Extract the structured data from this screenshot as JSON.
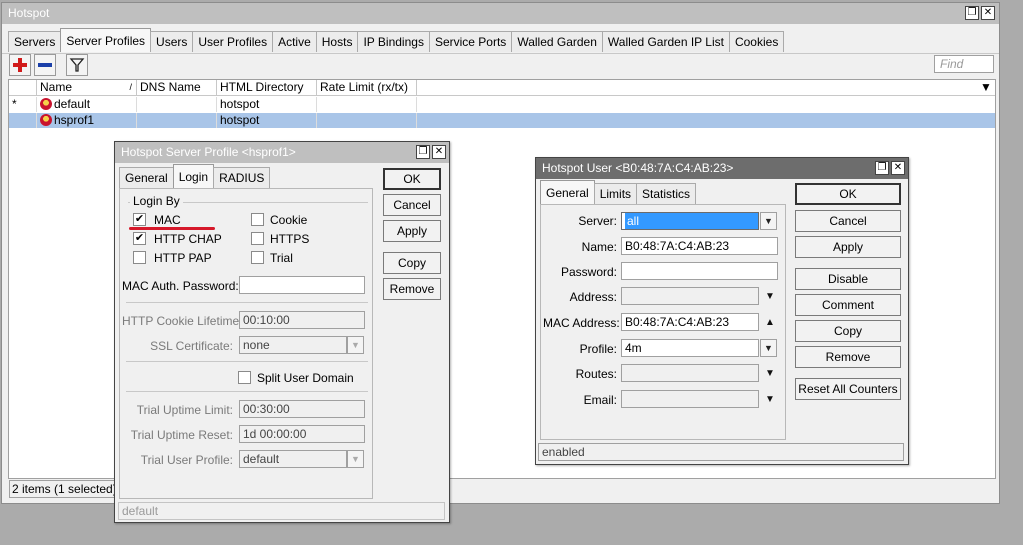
{
  "main": {
    "title": "Hotspot",
    "tabs": [
      "Servers",
      "Server Profiles",
      "Users",
      "User Profiles",
      "Active",
      "Hosts",
      "IP Bindings",
      "Service Ports",
      "Walled Garden",
      "Walled Garden IP List",
      "Cookies"
    ],
    "selected_tab": "Server Profiles",
    "find_placeholder": "Find",
    "columns": [
      "Name",
      "DNS Name",
      "HTML Directory",
      "Rate Limit (rx/tx)"
    ],
    "rows": [
      {
        "marker": "*",
        "name": "default",
        "dns": "",
        "html": "hotspot",
        "rate": "",
        "selected": false
      },
      {
        "marker": "",
        "name": "hsprof1",
        "dns": "",
        "html": "hotspot",
        "rate": "",
        "selected": true
      }
    ],
    "status": "2 items (1 selected)"
  },
  "profile_dialog": {
    "title": "Hotspot Server Profile <hsprof1>",
    "tabs": [
      "General",
      "Login",
      "RADIUS"
    ],
    "selected_tab": "Login",
    "login_by_title": "Login By",
    "checks": {
      "mac": {
        "label": "MAC",
        "checked": "✔"
      },
      "http_chap": {
        "label": "HTTP CHAP",
        "checked": "✔"
      },
      "http_pap": {
        "label": "HTTP PAP",
        "checked": ""
      },
      "cookie": {
        "label": "Cookie",
        "checked": ""
      },
      "https": {
        "label": "HTTPS",
        "checked": ""
      },
      "trial": {
        "label": "Trial",
        "checked": ""
      },
      "split": {
        "label": "Split User Domain",
        "checked": ""
      }
    },
    "mac_auth_password_label": "MAC Auth. Password:",
    "mac_auth_password": "",
    "http_cookie_lifetime_label": "HTTP Cookie Lifetime:",
    "http_cookie_lifetime": "00:10:00",
    "ssl_certificate_label": "SSL Certificate:",
    "ssl_certificate": "none",
    "trial_uptime_limit_label": "Trial Uptime Limit:",
    "trial_uptime_limit": "00:30:00",
    "trial_uptime_reset_label": "Trial Uptime Reset:",
    "trial_uptime_reset": "1d 00:00:00",
    "trial_user_profile_label": "Trial User Profile:",
    "trial_user_profile": "default",
    "buttons": {
      "ok": "OK",
      "cancel": "Cancel",
      "apply": "Apply",
      "copy": "Copy",
      "remove": "Remove"
    },
    "status": "default",
    "annotation_color": "#d6182a"
  },
  "user_dialog": {
    "title": "Hotspot User <B0:48:7A:C4:AB:23>",
    "tabs": [
      "General",
      "Limits",
      "Statistics"
    ],
    "selected_tab": "General",
    "server_label": "Server:",
    "server": "all",
    "name_label": "Name:",
    "name": "B0:48:7A:C4:AB:23",
    "password_label": "Password:",
    "password": "",
    "address_label": "Address:",
    "address": "",
    "mac_label": "MAC Address:",
    "mac": "B0:48:7A:C4:AB:23",
    "profile_label": "Profile:",
    "profile": "4m",
    "routes_label": "Routes:",
    "routes": "",
    "email_label": "Email:",
    "email": "",
    "buttons": {
      "ok": "OK",
      "cancel": "Cancel",
      "apply": "Apply",
      "disable": "Disable",
      "comment": "Comment",
      "copy": "Copy",
      "remove": "Remove",
      "reset": "Reset All Counters"
    },
    "status": "enabled"
  },
  "icons": {
    "add": "plus-icon",
    "remove": "minus-icon",
    "filter": "filter-icon",
    "restore": "restore-icon",
    "close": "close-icon"
  },
  "colors": {
    "selection": "#a9c5e8",
    "highlight": "#3399ff",
    "add": "#d11a1a",
    "remove": "#1a3fa8"
  }
}
